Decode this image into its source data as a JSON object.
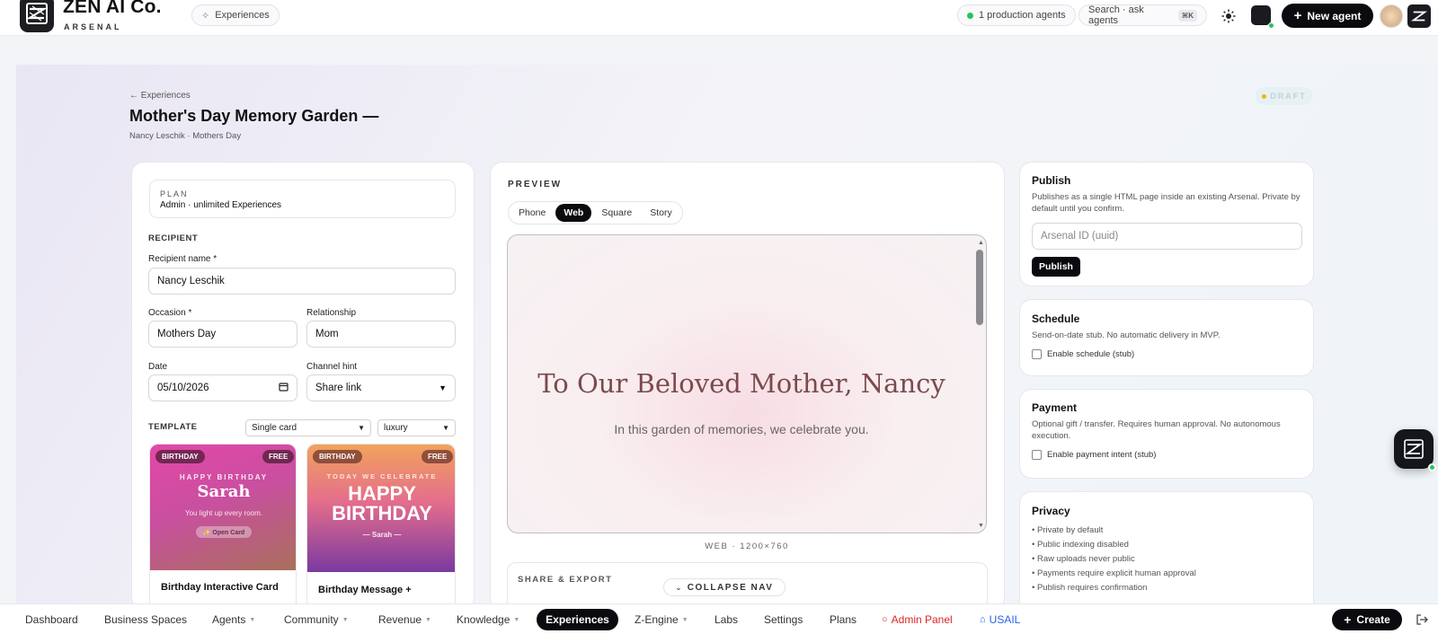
{
  "brand": {
    "name": "ZEN AI Co.",
    "sub": "ARSENAL"
  },
  "top": {
    "experiences_pill": "Experiences",
    "agents_pill": "1 production agents",
    "search": "Search · ask agents",
    "search_kbd": "⌘K",
    "new_agent": "New agent"
  },
  "page": {
    "back": "← Experiences",
    "title": "Mother's Day Memory Garden —",
    "subtitle": "Nancy Leschik · Mothers Day",
    "status": "DRAFT"
  },
  "form": {
    "plan_label": "PLAN",
    "plan_value": "Admin · unlimited Experiences",
    "recipient_section": "RECIPIENT",
    "recipient_name_label": "Recipient name *",
    "recipient_name_value": "Nancy Leschik",
    "occasion_label": "Occasion *",
    "occasion_value": "Mothers Day",
    "relationship_label": "Relationship",
    "relationship_value": "Mom",
    "date_label": "Date",
    "date_value": "05/10/2026",
    "channel_label": "Channel hint",
    "channel_value": "Share link",
    "template_section": "TEMPLATE",
    "template_type": "Single card",
    "template_style": "luxury"
  },
  "templates": [
    {
      "tag": "BIRTHDAY",
      "price": "FREE",
      "kicker": "HAPPY BIRTHDAY",
      "name": "Sarah",
      "line": "You light up every room.",
      "button": "✨ Open Card",
      "title": "Birthday Interactive Card"
    },
    {
      "tag": "BIRTHDAY",
      "price": "FREE",
      "kicker": "TODAY WE CELEBRATE",
      "headline1": "HAPPY",
      "headline2": "BIRTHDAY",
      "line": "— Sarah —",
      "title": "Birthday Message +"
    }
  ],
  "preview": {
    "label": "PREVIEW",
    "modes": [
      "Phone",
      "Web",
      "Square",
      "Story"
    ],
    "active_mode": "Web",
    "headline": "To Our Beloved Mother, Nancy",
    "subline": "In this garden of memories, we celebrate you.",
    "size_caption": "WEB · 1200×760",
    "share_label": "SHARE & EXPORT"
  },
  "publish": {
    "title": "Publish",
    "desc": "Publishes as a single HTML page inside an existing Arsenal. Private by default until you confirm.",
    "placeholder": "Arsenal ID (uuid)",
    "button": "Publish"
  },
  "schedule": {
    "title": "Schedule",
    "desc": "Send-on-date stub. No automatic delivery in MVP.",
    "checkbox": "Enable schedule (stub)"
  },
  "payment": {
    "title": "Payment",
    "desc": "Optional gift / transfer. Requires human approval. No autonomous execution.",
    "checkbox": "Enable payment intent (stub)"
  },
  "privacy": {
    "title": "Privacy",
    "items": [
      "• Private by default",
      "• Public indexing disabled",
      "• Raw uploads never public",
      "• Payments require explicit human approval",
      "• Publish requires confirmation"
    ]
  },
  "collapse_nav": "COLLAPSE NAV",
  "bottom_nav": {
    "items": [
      "Dashboard",
      "Business Spaces",
      "Agents",
      "Community",
      "Revenue",
      "Knowledge",
      "Experiences",
      "Z-Engine",
      "Labs",
      "Settings",
      "Plans",
      "Admin Panel",
      "USAIL"
    ],
    "active": "Experiences",
    "create": "Create"
  },
  "colors": {
    "accent_dark": "#0b0b0f",
    "admin_red": "#dc2626",
    "usail_blue": "#2563eb",
    "status_green": "#22c55e",
    "preview_text": "#7a4a4e"
  }
}
